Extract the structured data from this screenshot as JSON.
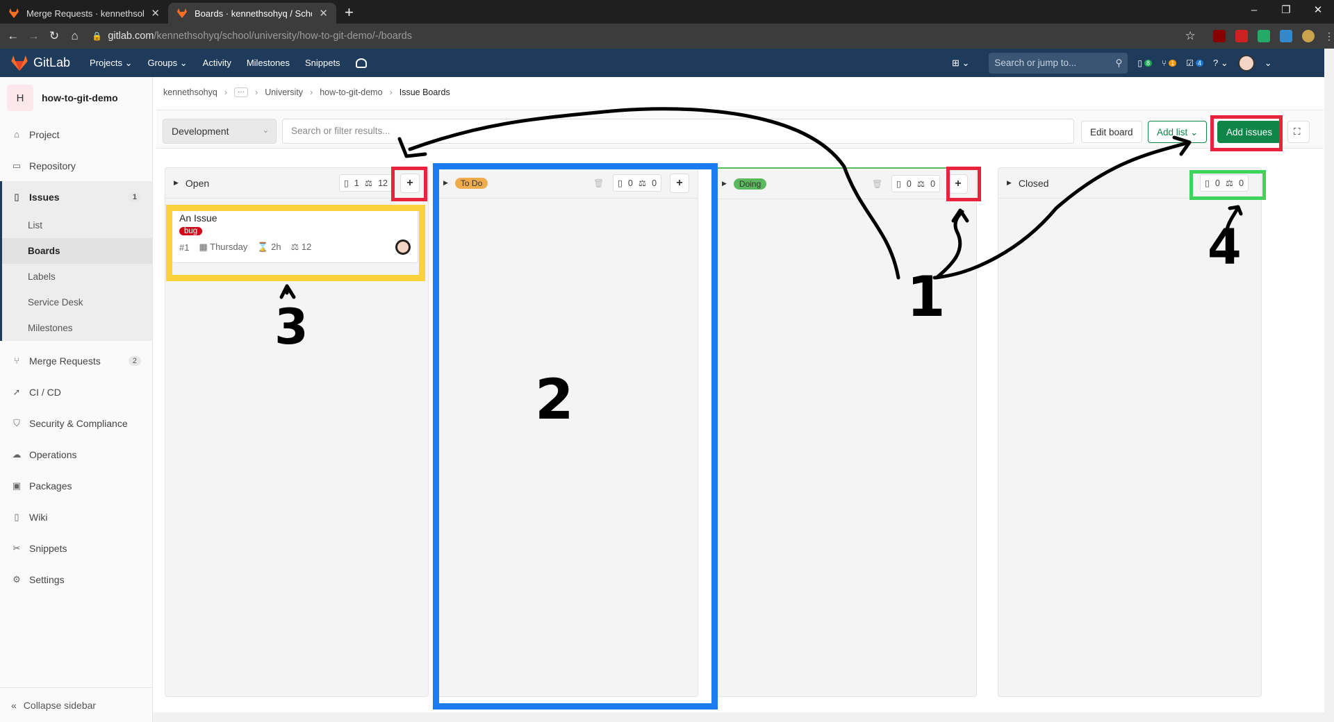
{
  "browser": {
    "tabs": [
      {
        "title": "Merge Requests · kennethsohyq",
        "active": false
      },
      {
        "title": "Boards · kennethsohyq / School /",
        "active": true
      }
    ],
    "url_host": "gitlab.com",
    "url_path": "/kennethsohyq/school/university/how-to-git-demo/-/boards",
    "window_controls": [
      "–",
      "❐",
      "✕"
    ]
  },
  "gitlab_nav": {
    "brand": "GitLab",
    "menu": [
      "Projects ⌄",
      "Groups ⌄",
      "Activity",
      "Milestones",
      "Snippets"
    ],
    "search_placeholder": "Search or jump to...",
    "issues_count": "8",
    "mr_count": "1",
    "todo_count": "4",
    "help": "? ⌄"
  },
  "sidebar": {
    "project_initial": "H",
    "project_name": "how-to-git-demo",
    "items": [
      {
        "label": "Project",
        "icon": "home-icon"
      },
      {
        "label": "Repository",
        "icon": "book-icon"
      },
      {
        "label": "Issues",
        "icon": "issues-icon",
        "count": "1"
      },
      {
        "label": "Merge Requests",
        "icon": "merge-request-icon",
        "count": "2"
      },
      {
        "label": "CI / CD",
        "icon": "rocket-icon"
      },
      {
        "label": "Security & Compliance",
        "icon": "shield-icon"
      },
      {
        "label": "Operations",
        "icon": "cloud-gear-icon"
      },
      {
        "label": "Packages",
        "icon": "package-icon"
      },
      {
        "label": "Wiki",
        "icon": "book-icon"
      },
      {
        "label": "Snippets",
        "icon": "scissors-icon"
      },
      {
        "label": "Settings",
        "icon": "gear-icon"
      }
    ],
    "issues_sub": [
      "List",
      "Boards",
      "Labels",
      "Service Desk",
      "Milestones"
    ],
    "collapse": "Collapse sidebar"
  },
  "breadcrumb": [
    "kennethsohyq",
    "University",
    "how-to-git-demo",
    "Issue Boards"
  ],
  "filter": {
    "board_select": "Development",
    "search_placeholder": "Search or filter results...",
    "edit_board": "Edit board",
    "add_list": "Add list",
    "add_issues": "Add issues"
  },
  "columns": [
    {
      "title": "Open",
      "issues": "1",
      "weight": "12"
    },
    {
      "title": "To Do",
      "issues": "0",
      "weight": "0",
      "label_color": "#f0ad4e"
    },
    {
      "title": "Doing",
      "issues": "0",
      "weight": "0",
      "label_color": "#5cb85c"
    },
    {
      "title": "Closed",
      "issues": "0",
      "weight": "0"
    }
  ],
  "card": {
    "title": "An Issue",
    "label": "bug",
    "ref": "#1",
    "due": "Thursday",
    "time": "2h",
    "weight": "12"
  },
  "annotations": {
    "n1": "1",
    "n2": "2",
    "n3": "3",
    "n4": "4"
  },
  "colors": {
    "annotation_red": "#e8243c",
    "annotation_blue": "#1a7cf0",
    "annotation_yellow": "#fbd13c",
    "annotation_green": "#3ed35a",
    "gitlab_nav": "#1f3b5c",
    "green_button": "#108548"
  }
}
